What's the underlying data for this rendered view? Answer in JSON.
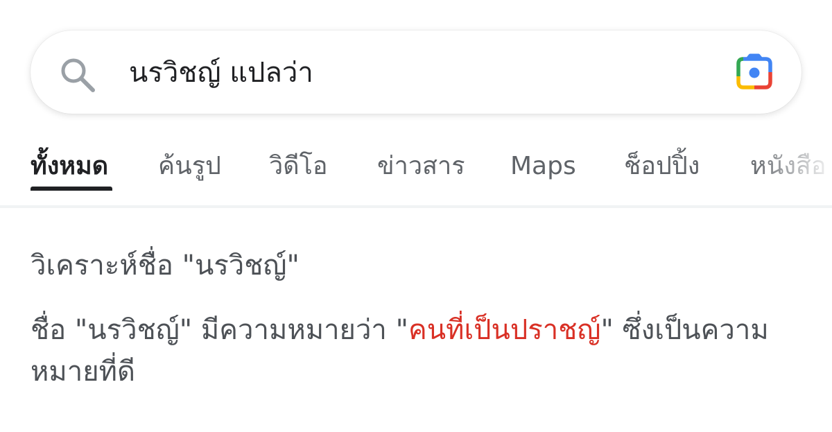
{
  "search": {
    "query": "นรวิชญ์ แปลว่า"
  },
  "icons": {
    "search": "search-icon",
    "lens": "google-lens-icon"
  },
  "tabs": [
    {
      "label": "ทั้งหมด",
      "active": true
    },
    {
      "label": "ค้นรูป",
      "active": false
    },
    {
      "label": "วิดีโอ",
      "active": false
    },
    {
      "label": "ข่าวสาร",
      "active": false
    },
    {
      "label": "Maps",
      "active": false
    },
    {
      "label": "ช็อปปิ้ง",
      "active": false
    },
    {
      "label": "หนังสือ",
      "active": false
    }
  ],
  "result": {
    "heading": "วิเคราะห์ชื่อ \"นรวิชญ์\"",
    "body_prefix": "ชื่อ \"นรวิชญ์\" มีความหมายว่า \"",
    "body_highlight": "คนที่เป็นปราชญ์",
    "body_suffix": "\" ซึ่งเป็นความหมายที่ดี"
  },
  "colors": {
    "highlight": "#d93025",
    "lens_blue": "#4285f4",
    "lens_red": "#ea4335",
    "lens_yellow": "#fbbc04",
    "lens_green": "#34a853"
  }
}
